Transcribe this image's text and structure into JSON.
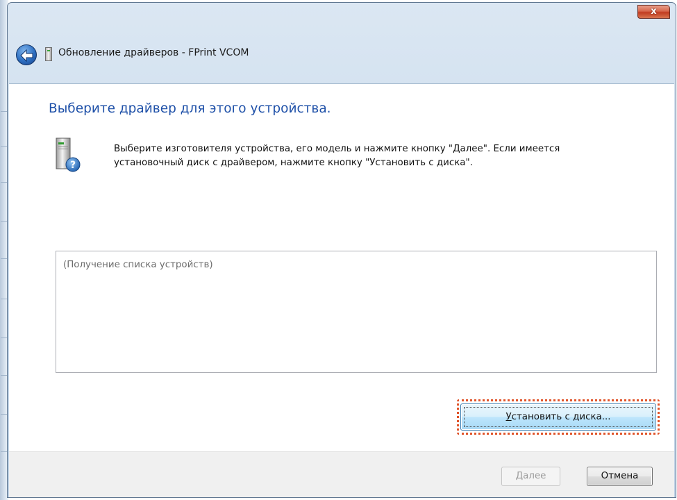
{
  "window": {
    "title": "Обновление драйверов - FPrint VCOM",
    "close_label": "x"
  },
  "main": {
    "heading": "Выберите драйвер для этого устройства.",
    "instruction_line1": "Выберите изготовителя устройства, его модель и нажмите кнопку \"Далее\". Если имеется",
    "instruction_line2": "установочный диск с  драйвером, нажмите кнопку \"Установить с диска\".",
    "device_list_placeholder": "(Получение списка устройств)",
    "install_button": {
      "accel": "У",
      "rest": "становить с диска..."
    }
  },
  "footer": {
    "next_button": {
      "accel": "Д",
      "rest": "алее"
    },
    "cancel_button": "Отмена"
  },
  "colors": {
    "heading": "#1e50a8",
    "highlight": "#e0542a",
    "close_button": "#c13b20"
  }
}
